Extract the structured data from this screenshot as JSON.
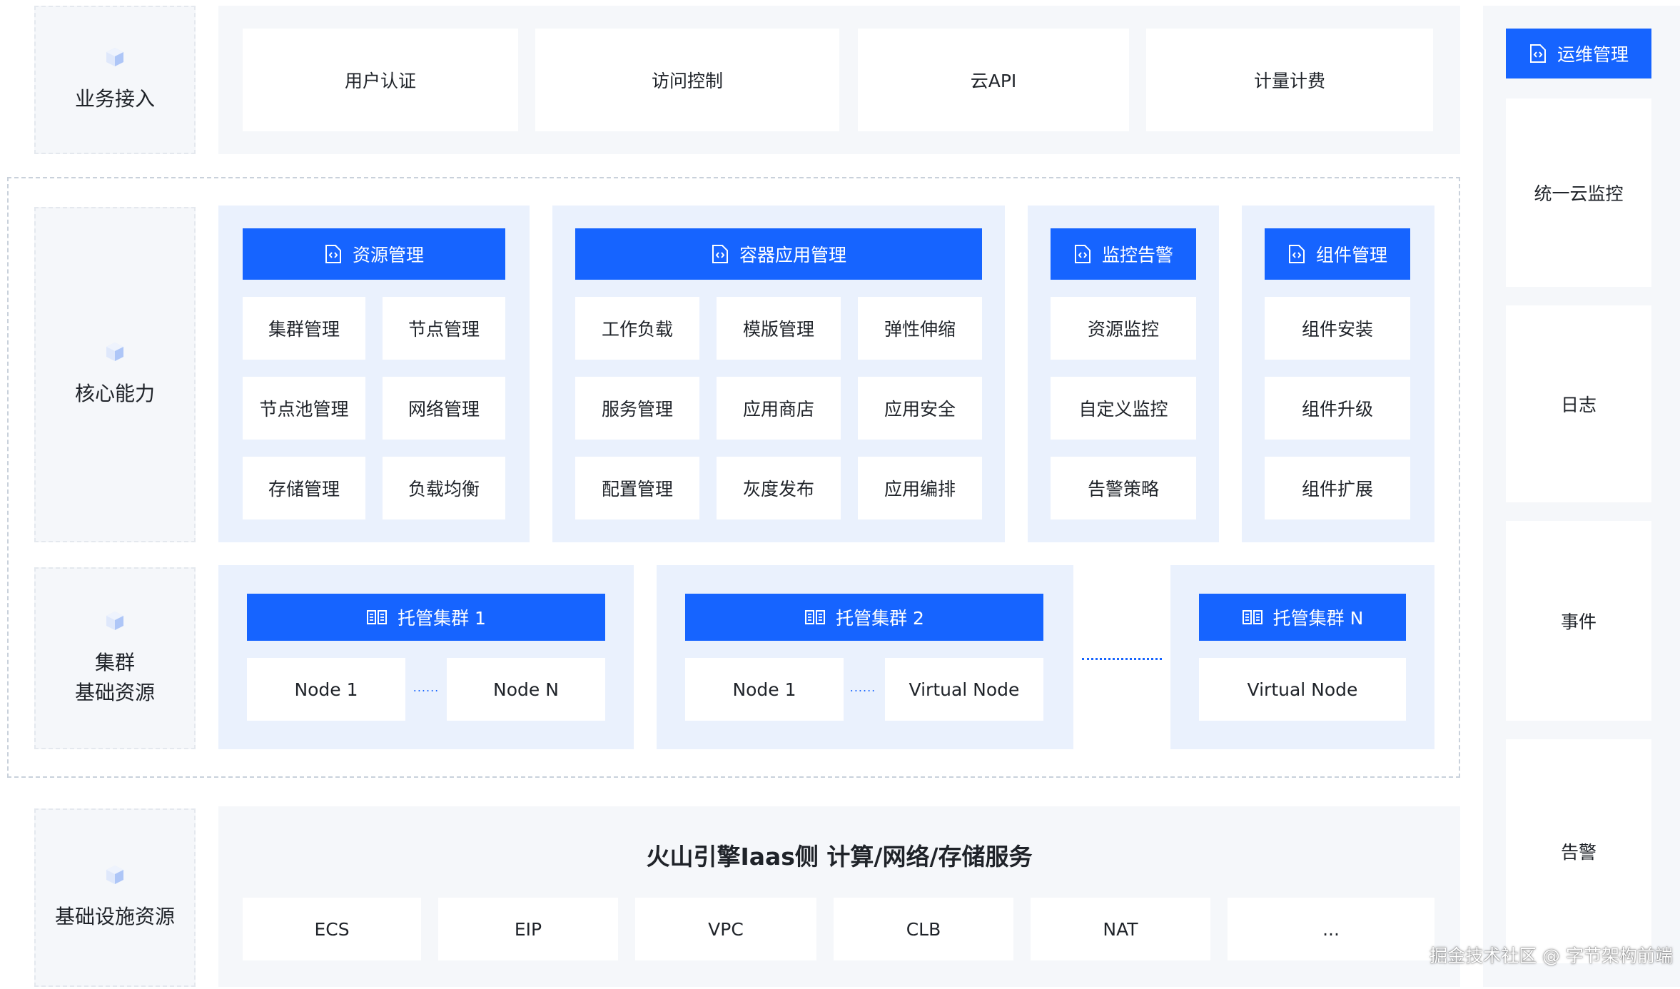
{
  "layers": {
    "business_access": "业务接入",
    "core_capability": "核心能力",
    "cluster_resources_line1": "集群",
    "cluster_resources_line2": "基础资源",
    "infrastructure": "基础设施资源"
  },
  "business_access_items": [
    "用户认证",
    "访问控制",
    "云API",
    "计量计费"
  ],
  "core": {
    "resource_mgmt": {
      "title": "资源管理",
      "items": [
        "集群管理",
        "节点管理",
        "节点池管理",
        "网络管理",
        "存储管理",
        "负载均衡"
      ]
    },
    "container_app_mgmt": {
      "title": "容器应用管理",
      "items": [
        "工作负载",
        "模版管理",
        "弹性伸缩",
        "服务管理",
        "应用商店",
        "应用安全",
        "配置管理",
        "灰度发布",
        "应用编排"
      ]
    },
    "monitoring_alerts": {
      "title": "监控告警",
      "items": [
        "资源监控",
        "自定义监控",
        "告警策略"
      ]
    },
    "component_mgmt": {
      "title": "组件管理",
      "items": [
        "组件安装",
        "组件升级",
        "组件扩展"
      ]
    }
  },
  "clusters": {
    "cluster1": {
      "title": "托管集群 1",
      "nodes": [
        "Node 1",
        "Node N"
      ]
    },
    "cluster2": {
      "title": "托管集群 2",
      "nodes": [
        "Node 1",
        "Virtual Node"
      ]
    },
    "clusterN": {
      "title": "托管集群 N",
      "nodes": [
        "Virtual Node"
      ]
    },
    "ellipsis_small": "......"
  },
  "infra": {
    "title": "火山引擎Iaas侧 计算/网络/存储服务",
    "items": [
      "ECS",
      "EIP",
      "VPC",
      "CLB",
      "NAT",
      "..."
    ]
  },
  "ops": {
    "title": "运维管理",
    "items": [
      "统一云监控",
      "日志",
      "事件",
      "告警"
    ]
  },
  "watermark": "掘金技术社区 @ 字节架构前端",
  "colors": {
    "accent": "#1664ff",
    "panel": "#eaf1fd",
    "background": "#f5f7fa"
  }
}
